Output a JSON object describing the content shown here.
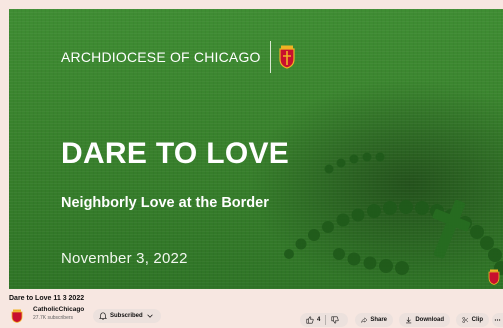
{
  "video": {
    "brand": "ARCHDIOCESE OF CHICAGO",
    "headline": "DARE TO LOVE",
    "subheadline": "Neighborly Love at the Border",
    "date": "November 3, 2022"
  },
  "meta": {
    "title": "Dare to Love 11 3 2022",
    "channel_name": "CatholicChicago",
    "subscriber_count": "27.7K subscribers",
    "subscribe_label": "Subscribed",
    "like_count": "4",
    "share_label": "Share",
    "download_label": "Download",
    "clip_label": "Clip"
  },
  "colors": {
    "slide_green": "#3f8d33",
    "crest_red": "#c8102e",
    "crest_gold": "#f0b323",
    "page_bg": "#f7e7e1"
  },
  "icons": [
    "crest-icon",
    "bell-icon",
    "chevron-down-icon",
    "thumbs-up-icon",
    "thumbs-down-icon",
    "share-icon",
    "download-icon",
    "scissors-icon",
    "more-icon"
  ]
}
